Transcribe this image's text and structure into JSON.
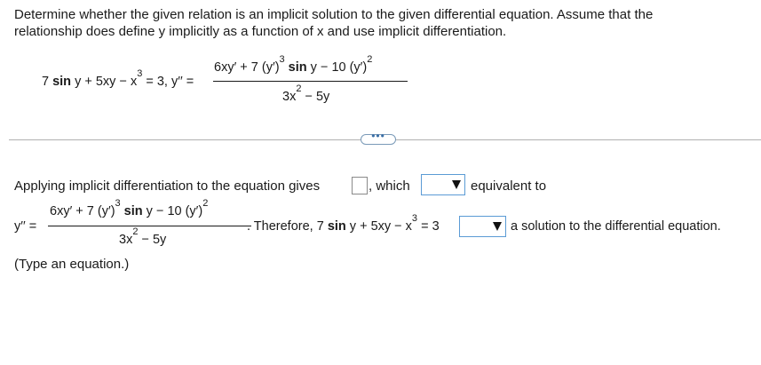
{
  "instructions": {
    "line1": "Determine whether the given relation is an implicit solution to the given differential equation. Assume that the",
    "line2": "relationship does define y implicitly as a function of x and use implicit differentiation."
  },
  "relation": {
    "lhs_a": "7 ",
    "sin": "sin",
    "lhs_b": " y + 5xy − x",
    "exp": "3",
    "rhs": " = 3, y′′ ="
  },
  "ode": {
    "num_a": "6xy′ + 7 (y′)",
    "num_exp1": "3",
    "num_sin": " sin",
    "num_b": " y − 10 (y′)",
    "num_exp2": "2",
    "den_a": "3x",
    "den_exp": "2",
    "den_b": " − 5y"
  },
  "more_button": {
    "label": "•••"
  },
  "answer": {
    "lead": "Applying implicit differentiation to the equation gives",
    "which": ", which",
    "equivalent": "equivalent to",
    "yprime": "y′′ =",
    "therefore_a": ". Therefore, 7 ",
    "therefore_sin": "sin",
    "therefore_b": " y + 5xy − x",
    "therefore_exp": "3",
    "therefore_c": " = 3",
    "solution": "a solution to the differential equation.",
    "hint": "(Type an equation.)"
  },
  "dropdowns": {
    "equivalent_select": {
      "value": ""
    },
    "solution_select": {
      "value": ""
    }
  },
  "colors": {
    "dropdown_border": "#5b9bd5",
    "link": "#3a6ea5"
  }
}
